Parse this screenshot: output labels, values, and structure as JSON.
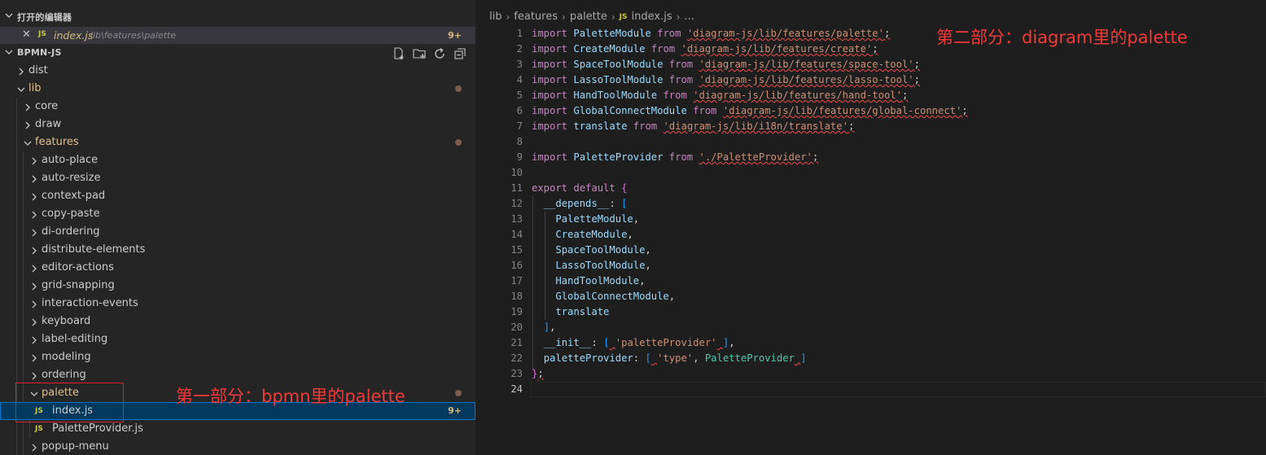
{
  "sidebar": {
    "open_editors": {
      "header": "打开的编辑器",
      "files": [
        {
          "icon": "JS",
          "name": "index.js",
          "path": "lib\\features\\palette",
          "badge": "9+"
        }
      ]
    },
    "project": {
      "header": "BPMN-JS",
      "tree": [
        {
          "label": "dist",
          "expanded": false
        },
        {
          "label": "lib",
          "expanded": true
        },
        {
          "label": "core",
          "expanded": false
        },
        {
          "label": "draw",
          "expanded": false
        },
        {
          "label": "features",
          "expanded": true
        },
        {
          "label": "auto-place",
          "expanded": false
        },
        {
          "label": "auto-resize",
          "expanded": false
        },
        {
          "label": "context-pad",
          "expanded": false
        },
        {
          "label": "copy-paste",
          "expanded": false
        },
        {
          "label": "di-ordering",
          "expanded": false
        },
        {
          "label": "distribute-elements",
          "expanded": false
        },
        {
          "label": "editor-actions",
          "expanded": false
        },
        {
          "label": "grid-snapping",
          "expanded": false
        },
        {
          "label": "interaction-events",
          "expanded": false
        },
        {
          "label": "keyboard",
          "expanded": false
        },
        {
          "label": "label-editing",
          "expanded": false
        },
        {
          "label": "modeling",
          "expanded": false
        },
        {
          "label": "ordering",
          "expanded": false
        },
        {
          "label": "palette",
          "expanded": true
        },
        {
          "label": "index.js",
          "icon": "JS",
          "badge": "9+",
          "selected": true
        },
        {
          "label": "PaletteProvider.js",
          "icon": "JS"
        },
        {
          "label": "popup-menu",
          "expanded": false
        }
      ]
    }
  },
  "editor": {
    "breadcrumb": [
      "lib",
      "features",
      "palette",
      "index.js",
      "..."
    ],
    "breadcrumb_js_icon": "JS",
    "line_numbers": [
      "1",
      "2",
      "3",
      "4",
      "5",
      "6",
      "7",
      "8",
      "9",
      "10",
      "11",
      "12",
      "13",
      "14",
      "15",
      "16",
      "17",
      "18",
      "19",
      "20",
      "21",
      "22",
      "23",
      "24"
    ],
    "code": {
      "kw_import": "import",
      "kw_from": "from",
      "kw_export": "export",
      "kw_default": "default",
      "imports": [
        {
          "name": "PaletteModule",
          "path": "'diagram-js/lib/features/palette'"
        },
        {
          "name": "CreateModule",
          "path": "'diagram-js/lib/features/create'"
        },
        {
          "name": "SpaceToolModule",
          "path": "'diagram-js/lib/features/space-tool'"
        },
        {
          "name": "LassoToolModule",
          "path": "'diagram-js/lib/features/lasso-tool'"
        },
        {
          "name": "HandToolModule",
          "path": "'diagram-js/lib/features/hand-tool'"
        },
        {
          "name": "GlobalConnectModule",
          "path": "'diagram-js/lib/features/global-connect'"
        },
        {
          "name": "translate",
          "path": "'diagram-js/lib/i18n/translate'"
        }
      ],
      "local_import": {
        "name": "PaletteProvider",
        "path": "'./PaletteProvider'"
      },
      "depends_key": "__depends__",
      "depends": [
        "PaletteModule",
        "CreateModule",
        "SpaceToolModule",
        "LassoToolModule",
        "HandToolModule",
        "GlobalConnectModule",
        "translate"
      ],
      "init_key": "__init__",
      "init_value": "'paletteProvider'",
      "provider_key": "paletteProvider",
      "provider_type": "'type'",
      "provider_class": "PaletteProvider"
    }
  },
  "annotations": {
    "part1": "第一部分：bpmn里的palette",
    "part2": "第二部分：diagram里的palette"
  },
  "colors": {
    "annotation": "#f03a3a",
    "modified": "#e2c08d",
    "selection": "#04395e"
  }
}
